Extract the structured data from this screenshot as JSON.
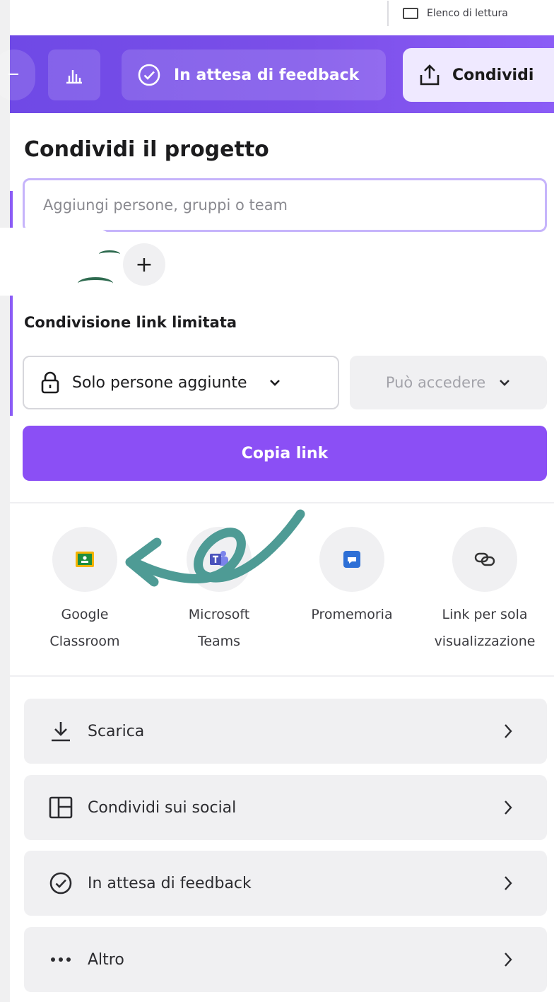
{
  "toolbar": {
    "reading_list_label": "Elenco di lettura",
    "feedback_label": "In attesa di feedback",
    "share_label": "Condividi"
  },
  "share_panel": {
    "title": "Condividi il progetto",
    "people_input_placeholder": "Aggiungi persone, gruppi o team",
    "link_section_label": "Condivisione link limitata",
    "access_scope_value": "Solo persone aggiunte",
    "permission_value": "Può accedere",
    "copy_link_label": "Copia link"
  },
  "apps": [
    {
      "line1": "Google",
      "line2": "Classroom",
      "icon": "google-classroom-icon"
    },
    {
      "line1": "Microsoft",
      "line2": "Teams",
      "icon": "microsoft-teams-icon"
    },
    {
      "line1": "Promemoria",
      "line2": "",
      "icon": "reminder-icon"
    },
    {
      "line1": "Link per sola",
      "line2": "visualizzazione",
      "icon": "link-icon"
    }
  ],
  "actions": [
    {
      "label": "Scarica",
      "icon": "download-icon"
    },
    {
      "label": "Condividi sui social",
      "icon": "social-layout-icon"
    },
    {
      "label": "In attesa di feedback",
      "icon": "check-circle-icon"
    },
    {
      "label": "Altro",
      "icon": "more-dots-icon"
    }
  ],
  "colors": {
    "brand_purple": "#8b4ff5",
    "toolbar_purple": "#7b4fe9",
    "annotation_arrow": "#4e9b95"
  }
}
